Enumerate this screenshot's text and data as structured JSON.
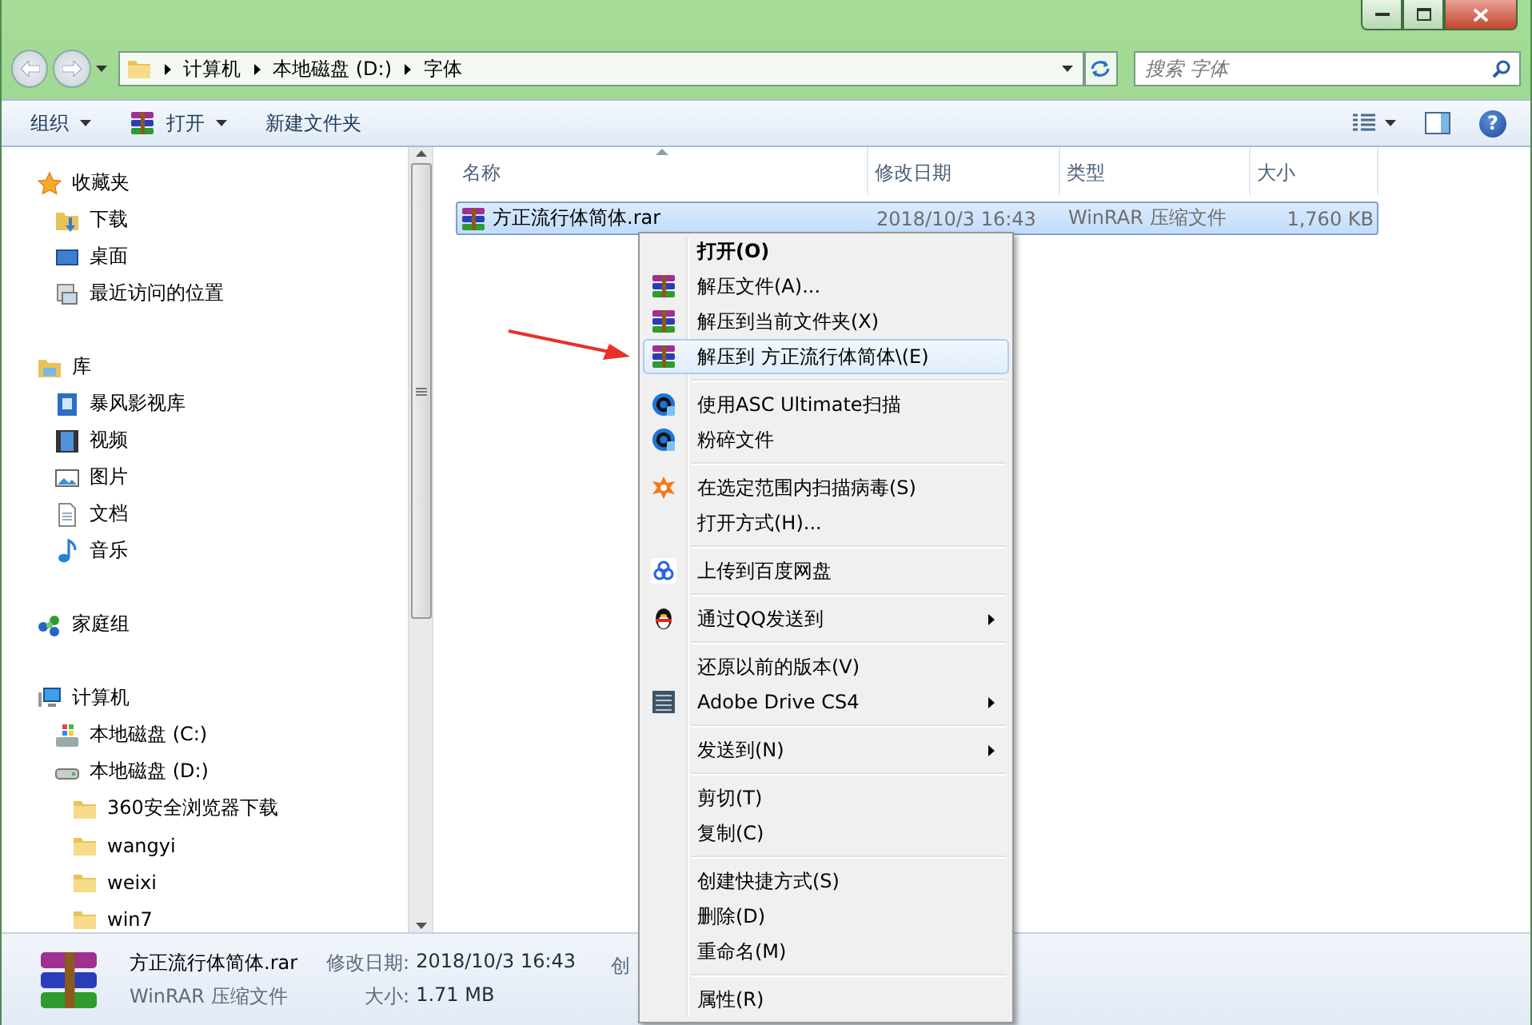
{
  "address_bar": {
    "path": [
      "计算机",
      "本地磁盘 (D:)",
      "字体"
    ]
  },
  "search": {
    "placeholder": "搜索 字体"
  },
  "toolbar": {
    "buttons": [
      {
        "label": "组织",
        "kind": "menu"
      },
      {
        "label": "打开",
        "kind": "open"
      },
      {
        "label": "新建文件夹",
        "kind": "plain"
      }
    ],
    "help_button": {
      "label": "?"
    }
  },
  "sidebar": {
    "sections": [
      {
        "label": "收藏夹",
        "kind": "star",
        "children": [
          {
            "label": "下载",
            "kind": "download"
          },
          {
            "label": "桌面",
            "kind": "desktop"
          },
          {
            "label": "最近访问的位置",
            "kind": "recent"
          }
        ]
      },
      {
        "label": "库",
        "kind": "library",
        "children": [
          {
            "label": "暴风影视库",
            "kind": "videolib"
          },
          {
            "label": "视频",
            "kind": "film"
          },
          {
            "label": "图片",
            "kind": "picture"
          },
          {
            "label": "文档",
            "kind": "document"
          },
          {
            "label": "音乐",
            "kind": "music"
          }
        ]
      },
      {
        "label": "家庭组",
        "kind": "homegroup"
      },
      {
        "label": "计算机",
        "kind": "computer",
        "children": [
          {
            "label": "本地磁盘 (C:)",
            "kind": "windrive"
          },
          {
            "label": "本地磁盘 (D:)",
            "kind": "drive",
            "children": [
              {
                "label": "360安全浏览器下载",
                "kind": "folder"
              },
              {
                "label": "wangyi",
                "kind": "folder"
              },
              {
                "label": "weixi",
                "kind": "folder"
              },
              {
                "label": "win7",
                "kind": "folder"
              }
            ]
          }
        ]
      }
    ]
  },
  "file_list": {
    "columns": [
      {
        "label": "名称",
        "sorted": true
      },
      {
        "label": "修改日期",
        "sorted": false
      },
      {
        "label": "类型",
        "sorted": false
      },
      {
        "label": "大小",
        "sorted": false
      }
    ],
    "rows": [
      {
        "name": "方正流行体简体.rar",
        "date": "2018/10/3 16:43",
        "type": "WinRAR 压缩文件",
        "size": "1,760 KB",
        "selected": true
      }
    ]
  },
  "context_menu": {
    "items": [
      {
        "kind": "default",
        "label": "打开(O)",
        "submenu": false,
        "selected": false
      },
      {
        "kind": "rar",
        "label": "解压文件(A)...",
        "submenu": false,
        "selected": false
      },
      {
        "kind": "rar",
        "label": "解压到当前文件夹(X)",
        "submenu": false,
        "selected": false
      },
      {
        "kind": "rar",
        "label": "解压到 方正流行体简体\\(E)",
        "submenu": false,
        "selected": true
      },
      {
        "kind": "separator"
      },
      {
        "kind": "scan",
        "label": "使用ASC Ultimate扫描",
        "submenu": false,
        "selected": false
      },
      {
        "kind": "scan",
        "label": "粉碎文件",
        "submenu": false,
        "selected": false
      },
      {
        "kind": "separator"
      },
      {
        "kind": "antivirus",
        "label": "在选定范围内扫描病毒(S)",
        "submenu": false,
        "selected": false
      },
      {
        "kind": "plain",
        "label": "打开方式(H)...",
        "submenu": false,
        "selected": false
      },
      {
        "kind": "separator"
      },
      {
        "kind": "cloud",
        "label": "上传到百度网盘",
        "submenu": false,
        "selected": false
      },
      {
        "kind": "separator"
      },
      {
        "kind": "penguin",
        "label": "通过QQ发送到",
        "submenu": true,
        "selected": false
      },
      {
        "kind": "separator"
      },
      {
        "kind": "plain",
        "label": "还原以前的版本(V)",
        "submenu": false,
        "selected": false
      },
      {
        "kind": "drive",
        "label": "Adobe Drive CS4",
        "submenu": true,
        "selected": false
      },
      {
        "kind": "separator"
      },
      {
        "kind": "plain",
        "label": "发送到(N)",
        "submenu": true,
        "selected": false
      },
      {
        "kind": "separator"
      },
      {
        "kind": "plain",
        "label": "剪切(T)",
        "submenu": false,
        "selected": false
      },
      {
        "kind": "plain",
        "label": "复制(C)",
        "submenu": false,
        "selected": false
      },
      {
        "kind": "separator"
      },
      {
        "kind": "plain",
        "label": "创建快捷方式(S)",
        "submenu": false,
        "selected": false
      },
      {
        "kind": "plain",
        "label": "删除(D)",
        "submenu": false,
        "selected": false
      },
      {
        "kind": "plain",
        "label": "重命名(M)",
        "submenu": false,
        "selected": false
      },
      {
        "kind": "separator"
      },
      {
        "kind": "plain",
        "label": "属性(R)",
        "submenu": false,
        "selected": false
      }
    ]
  },
  "details": {
    "name": "方正流行体简体.rar",
    "type": "WinRAR 压缩文件",
    "fields": [
      {
        "label": "修改日期:",
        "value": "2018/10/3 16:43"
      },
      {
        "label": "大小:",
        "value": "1.71 MB"
      },
      {
        "label": "创"
      }
    ]
  }
}
